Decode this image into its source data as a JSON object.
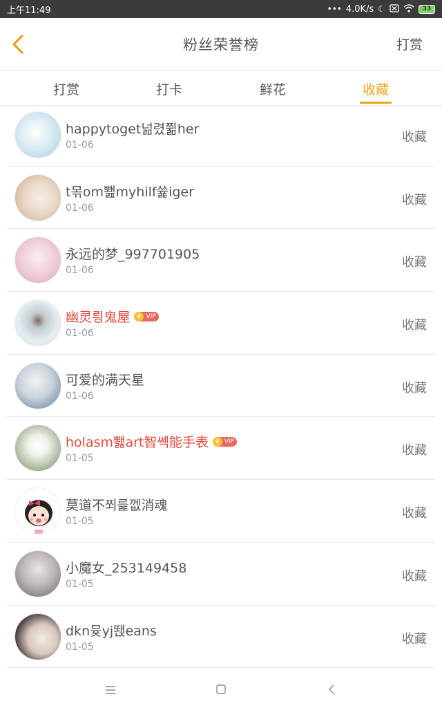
{
  "status_bar": {
    "time": "上午11:49",
    "network_speed": "4.0K/s",
    "battery": "33",
    "colors": {
      "background": "#3b3b3b",
      "battery": "#7fd16a"
    }
  },
  "header": {
    "title": "粉丝荣誉榜",
    "action_label": "打赏",
    "back_icon": "chevron-left-icon",
    "accent_color": "#f2a21a"
  },
  "tabs": [
    {
      "label": "打赏",
      "active": false
    },
    {
      "label": "打卡",
      "active": false
    },
    {
      "label": "鲜花",
      "active": false
    },
    {
      "label": "收藏",
      "active": true
    }
  ],
  "vip_label": "VIP",
  "entries": [
    {
      "name": "happytoget넒렸쮦her",
      "date": "01-06",
      "action": "收藏",
      "vip": false
    },
    {
      "name": "t몪om뾆myhilf쓡iger",
      "date": "01-06",
      "action": "收藏",
      "vip": false
    },
    {
      "name": "永远的梦_997701905",
      "date": "01-06",
      "action": "收藏",
      "vip": false
    },
    {
      "name": "幽灵릥鬼屋",
      "date": "01-06",
      "action": "收藏",
      "vip": true
    },
    {
      "name": "可爱的满天星",
      "date": "01-06",
      "action": "收藏",
      "vip": false
    },
    {
      "name": "holasm뾇art智쎅能手表",
      "date": "01-05",
      "action": "收藏",
      "vip": true
    },
    {
      "name": "莫道不쬐릁껪消魂",
      "date": "01-05",
      "action": "收藏",
      "vip": false
    },
    {
      "name": "小魔女_253149458",
      "date": "01-05",
      "action": "收藏",
      "vip": false
    },
    {
      "name": "dkn뮺yj뙍eans",
      "date": "01-05",
      "action": "收藏",
      "vip": false
    }
  ],
  "bottom_nav": {
    "icons": [
      "menu-icon",
      "home-square-icon",
      "back-triangle-icon"
    ]
  }
}
